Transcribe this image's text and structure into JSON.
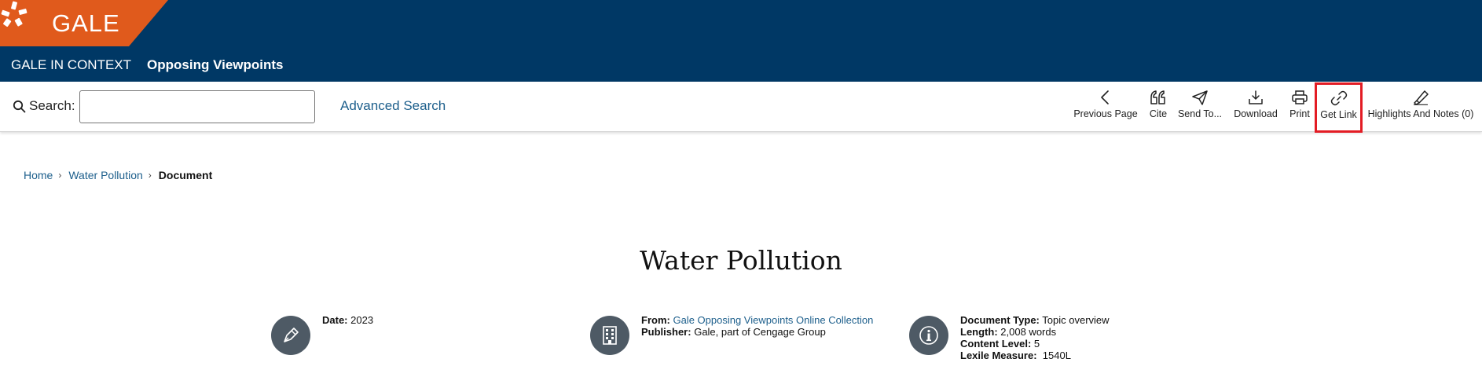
{
  "header": {
    "logo_text": "GALE",
    "platform_name": "GALE IN CONTEXT",
    "product_name": "Opposing Viewpoints"
  },
  "search": {
    "label": "Search:",
    "value": "",
    "placeholder": "",
    "advanced_label": "Advanced Search"
  },
  "tools": {
    "previous_page": "Previous Page",
    "cite": "Cite",
    "send_to": "Send To...",
    "download": "Download",
    "print": "Print",
    "get_link": "Get Link",
    "highlights": "Highlights And Notes (0)"
  },
  "breadcrumb": {
    "home": "Home",
    "topic": "Water Pollution",
    "current": "Document"
  },
  "document": {
    "title": "Water Pollution",
    "date_label": "Date:",
    "date_value": "2023",
    "from_label": "From:",
    "from_value": "Gale Opposing Viewpoints Online Collection",
    "publisher_label": "Publisher:",
    "publisher_value": "Gale, part of Cengage Group",
    "doctype_label": "Document Type:",
    "doctype_value": "Topic overview",
    "length_label": "Length:",
    "length_value": "2,008 words",
    "content_level_label": "Content Level:",
    "content_level_value": "5",
    "lexile_label": "Lexile Measure:",
    "lexile_value": "1540L"
  },
  "colors": {
    "header_bg": "#003865",
    "logo_orange": "#e05a1c",
    "link_blue": "#1d5f8c",
    "highlight_red": "#e31c24",
    "meta_icon_bg": "#4e5a65"
  }
}
